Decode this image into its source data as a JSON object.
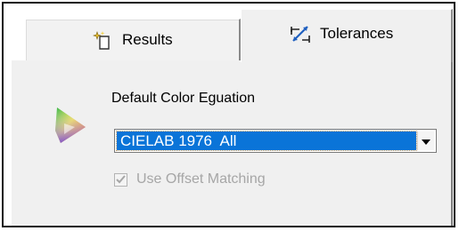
{
  "tabs": [
    {
      "label": "Results",
      "icon": "sparkle-document-icon",
      "selected": false
    },
    {
      "label": "Tolerances",
      "icon": "tolerance-arrows-icon",
      "selected": true
    }
  ],
  "panel": {
    "equation_label": "Default Color Eguation",
    "equation_value": "CIELAB 1976  All",
    "use_offset_label": "Use Offset Matching",
    "use_offset_checked": true,
    "use_offset_enabled": false
  },
  "colors": {
    "selection": "#0a74d8",
    "panel_bg": "#f0f0f0",
    "disabled_text": "#a6a6a6"
  }
}
